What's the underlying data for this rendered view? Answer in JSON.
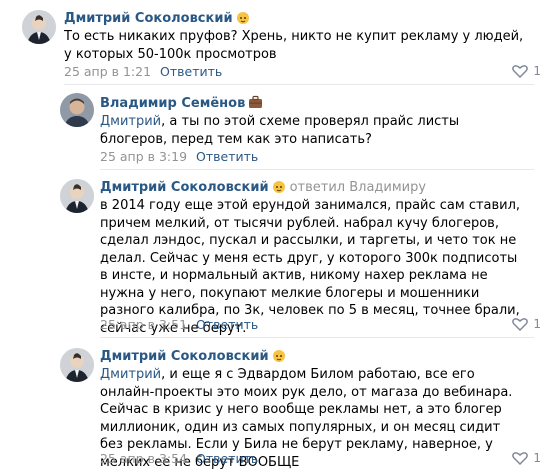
{
  "comments": [
    {
      "author": "Дмитрий Соколовский",
      "badge": "cat-emoji",
      "text_before": "То есть никаких пруфов? Хрень, никто не купит рекламу у людей, у которых 50-100к просмотров",
      "date": "25 апр в 1:21",
      "reply": "Ответить",
      "likes": "1"
    },
    {
      "author": "Владимир Семёнов",
      "badge": "briefcase-emoji",
      "mention": "Дмитрий",
      "text": ", а ты по этой схеме проверял прайс листы блогеров, перед тем как это написать?",
      "date": "25 апр в 3:19",
      "reply": "Ответить"
    },
    {
      "author": "Дмитрий Соколовский",
      "badge": "cat-emoji",
      "replied_to": "ответил Владимиру",
      "text": "в 2014 году еще этой ерундой занимался, прайс сам ставил, причем мелкий, от тысячи рублей. набрал кучу блогеров, сделал лэндос, пускал и рассылки, и таргеты, и чето ток не делал. Сейчас у меня есть друг, у которого 300к подписоты в инсте, и нормальный актив, никому нахер реклама не нужна у него, покупают мелкие блогеры и мошенники разного калибра, по 3к, человек по 5 в месяц, точнее брали, сейчас уже не берут.",
      "date": "25 апр в 3:51",
      "reply": "Ответить",
      "likes": "1"
    },
    {
      "author": "Дмитрий Соколовский",
      "badge": "cat-emoji",
      "mention": "Дмитрий",
      "text": ", и еще я с Эдвардом Билом работаю, все его онлайн-проекты это моих рук дело, от магаза до вебинара. Сейчас в кризис у него вообще рекламы нет, а это блогер миллионик, один из самых популярных, и он месяц сидит без рекламы. Если у Била не берут рекламу, наверное, у мелких ее не берут ВООБЩЕ",
      "date": "25 апр в 3:54",
      "reply": "Ответить",
      "likes": "1"
    }
  ],
  "colors": {
    "link": "#2a5885",
    "meta": "#939393",
    "like": "#828a99",
    "separator": "#e7e8ec"
  }
}
